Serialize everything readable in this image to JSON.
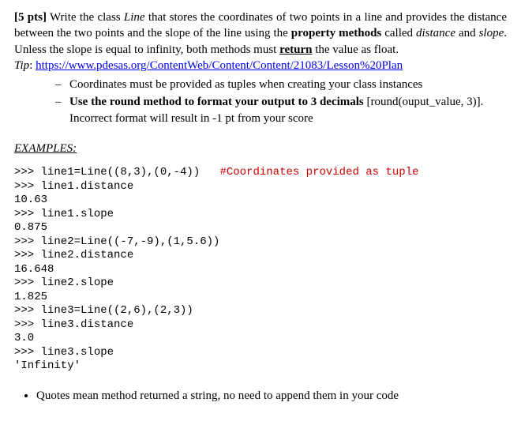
{
  "points_label": "[5 pts]",
  "intro_a": " Write the class ",
  "class_name": "Line",
  "intro_b": " that stores the coordinates of two points in a line and provides the distance between the two points and the slope of the line using the ",
  "prop_label": "property methods",
  "intro_c": " called ",
  "m_distance": "distance",
  "intro_d": " and ",
  "m_slope": "slope",
  "intro_e": ". Unless the slope is equal to infinity, both methods must ",
  "return_word": "return",
  "intro_f": " the value as float.",
  "tip_label": "Tip",
  "tip_url": "https://www.pdesas.org/ContentWeb/Content/Content/21083/Lesson%20Plan",
  "bullet1": "Coordinates must be provided as tuples when creating your class instances",
  "bullet2_bold": "Use the round method to format your output to 3 decimals",
  "bullet2_rest": " [round(ouput_value, 3)]. Incorrect format will result in -1 pt from your score",
  "examples_header": "EXAMPLES:",
  "code": {
    "l1a": ">>> line1=Line((8,3),(0,-4))   ",
    "l1b": "#Coordinates provided as tuple",
    "l2": ">>> line1.distance",
    "l3": "10.63",
    "l4": ">>> line1.slope",
    "l5": "0.875",
    "l6": ">>> line2=Line((-7,-9),(1,5.6))",
    "l7": ">>> line2.distance",
    "l8": "16.648",
    "l9": ">>> line2.slope",
    "l10": "1.825",
    "l11": ">>> line3=Line((2,6),(2,3))",
    "l12": ">>> line3.distance",
    "l13": "3.0",
    "l14": ">>> line3.slope",
    "l15": "'Infinity'"
  },
  "footer_note": "Quotes mean method returned a string, no need to append them in your code"
}
